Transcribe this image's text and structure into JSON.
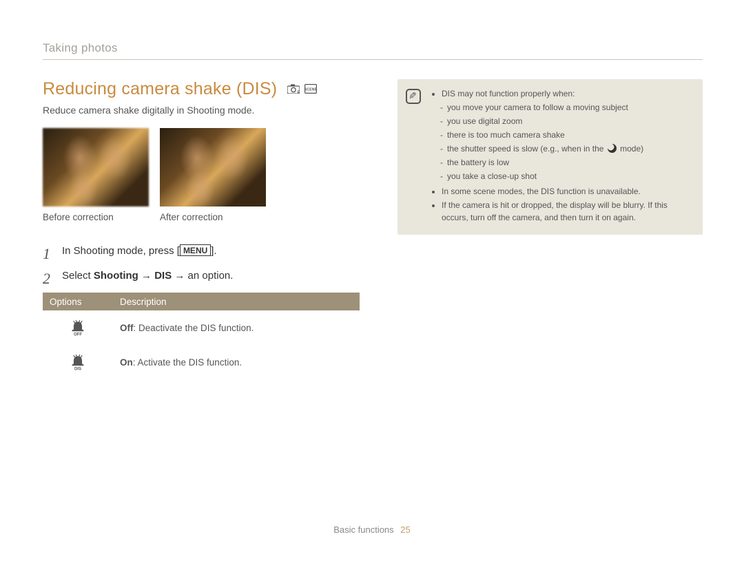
{
  "breadcrumb": "Taking photos",
  "title": "Reducing camera shake (DIS)",
  "subtitle": "Reduce camera shake digitally in Shooting mode.",
  "captions": {
    "before": "Before correction",
    "after": "After correction"
  },
  "steps": {
    "s1_pre": "In Shooting mode, press [",
    "s1_btn": "MENU",
    "s1_post": "].",
    "s2_pre": "Select ",
    "s2_bold1": "Shooting",
    "s2_arrow1": " → ",
    "s2_bold2": "DIS",
    "s2_post": " → an option."
  },
  "table": {
    "h1": "Options",
    "h2": "Description",
    "row1_label": "Off",
    "row1_desc": ": Deactivate the DIS function.",
    "row2_label": "On",
    "row2_desc": ": Activate the DIS function."
  },
  "note": {
    "intro": "DIS may not function properly when:",
    "d1": "you move your camera to follow a moving subject",
    "d2": "you use digital zoom",
    "d3": "there is too much camera shake",
    "d4_pre": "the shutter speed is slow (e.g., when in the ",
    "d4_post": " mode)",
    "d5": "the battery is low",
    "d6": "you take a close-up shot",
    "b2": "In some scene modes, the DIS function is unavailable.",
    "b3": "If the camera is hit or dropped, the display will be blurry. If this occurs, turn off the camera, and then turn it on again."
  },
  "footer": {
    "label": "Basic functions",
    "page": "25"
  }
}
